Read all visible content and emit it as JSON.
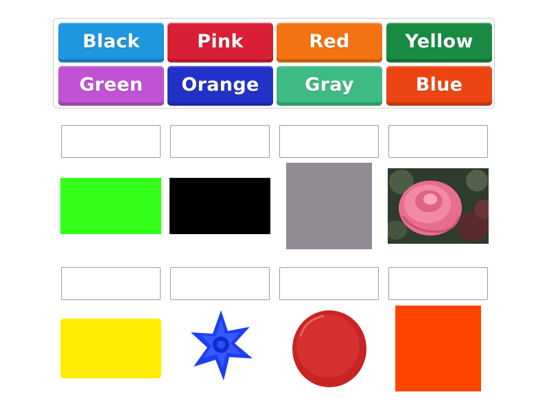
{
  "word_tiles": [
    {
      "label": "Black",
      "color": "#1e96e0"
    },
    {
      "label": "Pink",
      "color": "#d91f35"
    },
    {
      "label": "Red",
      "color": "#f57212"
    },
    {
      "label": "Yellow",
      "color": "#188a42"
    },
    {
      "label": "Green",
      "color": "#c053d4"
    },
    {
      "label": "Orange",
      "color": "#2232c8"
    },
    {
      "label": "Gray",
      "color": "#3dbb83"
    },
    {
      "label": "Blue",
      "color": "#ec4513"
    }
  ],
  "drop_slots_count_note": "",
  "pictures": [
    {
      "name": "green-swatch",
      "color": "#34ff1a"
    },
    {
      "name": "black-swatch",
      "color": "#000000"
    },
    {
      "name": "gray-swatch",
      "color": "#918b93"
    },
    {
      "name": "pink-rose-photo",
      "color": "#f07090"
    },
    {
      "name": "yellow-swatch",
      "color": "#ffec00"
    },
    {
      "name": "blue-flower-photo",
      "color": "#1a3ff0"
    },
    {
      "name": "red-paint-blob",
      "color": "#d22a2a"
    },
    {
      "name": "orange-swatch",
      "color": "#ff4500"
    }
  ]
}
